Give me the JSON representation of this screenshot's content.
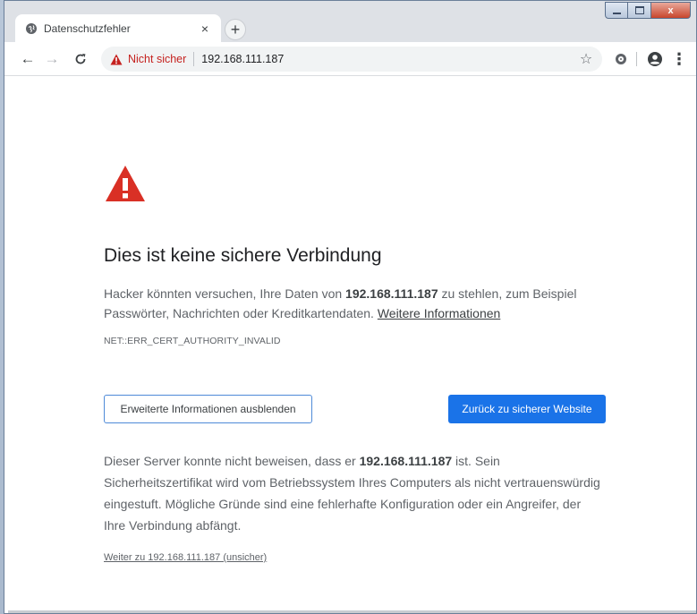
{
  "tab": {
    "title": "Datenschutzfehler",
    "close_glyph": "×",
    "favicon": "globe-icon"
  },
  "new_tab_glyph": "+",
  "window_controls": {
    "minimize": "—",
    "maximize": "☐",
    "close": "x"
  },
  "toolbar": {
    "back_glyph": "←",
    "forward_glyph": "→",
    "reload_glyph": "C",
    "security_label": "Nicht sicher",
    "url": "192.168.111.187",
    "bookmark_glyph": "☆",
    "menu_glyph": "⋮"
  },
  "interstitial": {
    "heading": "Dies ist keine sichere Verbindung",
    "para1_before": "Hacker könnten versuchen, Ihre Daten von ",
    "para1_host": "192.168.111.187",
    "para1_after": " zu stehlen, zum Beispiel Passwörter, Nachrichten oder Kreditkartendaten. ",
    "learn_more": "Weitere Informationen",
    "error_code": "NET::ERR_CERT_AUTHORITY_INVALID",
    "advanced_button": "Erweiterte Informationen ausblenden",
    "back_button": "Zurück zu sicherer Website",
    "para2_before": "Dieser Server konnte nicht beweisen, dass er ",
    "para2_host": "192.168.111.187",
    "para2_after": " ist. Sein Sicherheitszertifikat wird vom Betriebssystem Ihres Computers als nicht vertrauenswürdig eingestuft. Mögliche Gründe sind eine fehlerhafte Konfiguration oder ein Angreifer, der Ihre Verbindung abfängt.",
    "proceed_link": "Weiter zu 192.168.111.187 (unsicher)"
  },
  "colors": {
    "danger_red": "#d93025",
    "primary_blue": "#1a73e8",
    "text_gray": "#5f6368",
    "heading": "#202124"
  }
}
